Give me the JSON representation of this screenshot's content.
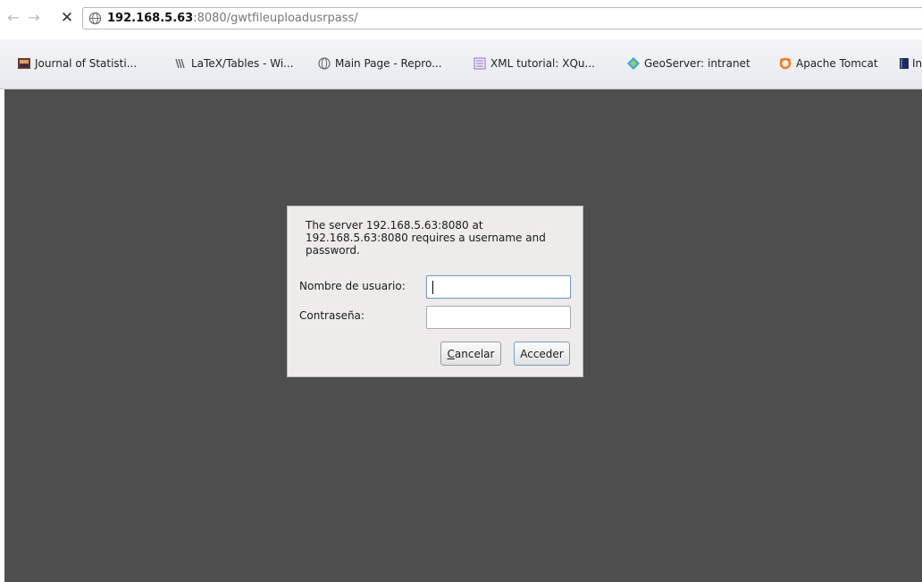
{
  "toolbar": {
    "back_icon": "arrow-left",
    "forward_icon": "arrow-right",
    "stop_icon": "close-x",
    "url_host": "192.168.5.63",
    "url_rest": ":8080/gwtfileuploadusrpass/"
  },
  "bookmarks": [
    {
      "label": "Journal of Statisti...",
      "icon": "journal-icon"
    },
    {
      "label": "LaTeX/Tables - Wi...",
      "icon": "wiki-icon"
    },
    {
      "label": "Main Page - Repro...",
      "icon": "globe-icon"
    },
    {
      "label": "XML tutorial: XQu...",
      "icon": "document-icon"
    },
    {
      "label": "GeoServer: intranet",
      "icon": "geoserver-icon"
    },
    {
      "label": "Apache Tomcat",
      "icon": "tomcat-icon"
    },
    {
      "label": "In",
      "icon": "book-icon"
    }
  ],
  "auth_dialog": {
    "message": "The server 192.168.5.63:8080 at 192.168.5.63:8080 requires a username and password.",
    "username_label": "Nombre de usuario:",
    "username_value": "",
    "password_label": "Contraseña:",
    "password_value": "",
    "cancel_label": "Cancelar",
    "accept_label": "Acceder"
  },
  "colors": {
    "content_background": "#4e4e4e",
    "dialog_background": "#edeceb",
    "focus_border": "#7a9cc8"
  }
}
